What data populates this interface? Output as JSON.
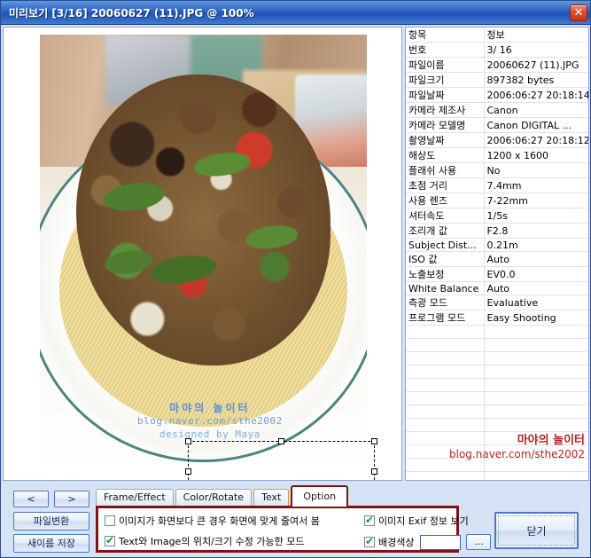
{
  "window": {
    "title": "미리보기 [3/16] 20060627 (11).JPG @ 100%",
    "close_icon": "close-window-icon",
    "close_glyph": "✕"
  },
  "metadata": {
    "header": {
      "key": "항목",
      "value": "정보"
    },
    "rows": [
      {
        "key": "번호",
        "value": "3/ 16"
      },
      {
        "key": "파일이름",
        "value": "20060627 (11).JPG"
      },
      {
        "key": "파일크기",
        "value": "897382 bytes"
      },
      {
        "key": "파일날짜",
        "value": "2006:06:27 20:18:14"
      },
      {
        "key": "카메라 제조사",
        "value": "Canon"
      },
      {
        "key": "카메라 모델명",
        "value": "Canon DIGITAL ..."
      },
      {
        "key": "촬영날짜",
        "value": "2006:06:27 20:18:12"
      },
      {
        "key": "해상도",
        "value": "1200 x 1600"
      },
      {
        "key": "플래쉬 사용",
        "value": "No"
      },
      {
        "key": "초점 거리",
        "value": "7.4mm"
      },
      {
        "key": "사용 렌즈",
        "value": "7-22mm"
      },
      {
        "key": "셔터속도",
        "value": "1/5s"
      },
      {
        "key": "조리개 값",
        "value": "F2.8"
      },
      {
        "key": "Subject Dist...",
        "value": "0.21m"
      },
      {
        "key": "ISO 값",
        "value": "Auto"
      },
      {
        "key": "노출보정",
        "value": "EV0.0"
      },
      {
        "key": "White Balance",
        "value": "Auto"
      },
      {
        "key": "측광 모드",
        "value": "Evaluative"
      },
      {
        "key": "프로그램 모드",
        "value": "Easy Shooting"
      }
    ],
    "empty_row_count": 14,
    "overlay": {
      "line1": "마야의 놀이터",
      "line2": "blog.naver.com/sthe2002",
      "color": "#b22222"
    }
  },
  "photo_watermark": {
    "line1": "마야의 놀이터",
    "line2": "blog.naver.com/sthe2002",
    "line3": "designed by Maya",
    "color": "#6ba0d8"
  },
  "nav": {
    "prev_label": "<",
    "next_label": ">",
    "convert_label": "파일변환",
    "save_as_label": "새이름 저장"
  },
  "tabs": [
    {
      "label": "Frame/Effect",
      "active": false
    },
    {
      "label": "Color/Rotate",
      "active": false
    },
    {
      "label": "Text",
      "active": false
    },
    {
      "label": "Option",
      "active": true
    }
  ],
  "options": {
    "opt1": {
      "label": "이미지가 화면보다 큰 경우 화면에 맞게 줄여서 봄",
      "checked": false
    },
    "opt2": {
      "label": "Text와 Image의 위치/크기 수정 가능한 모드",
      "checked": true
    },
    "opt3": {
      "label": "이미지 Exif 정보 보기",
      "checked": true
    },
    "opt4": {
      "label": "배경색상",
      "checked": true
    },
    "color_value": "",
    "browse_label": "...",
    "panel_border_color": "#7d1414"
  },
  "footer": {
    "close_label": "닫기"
  }
}
